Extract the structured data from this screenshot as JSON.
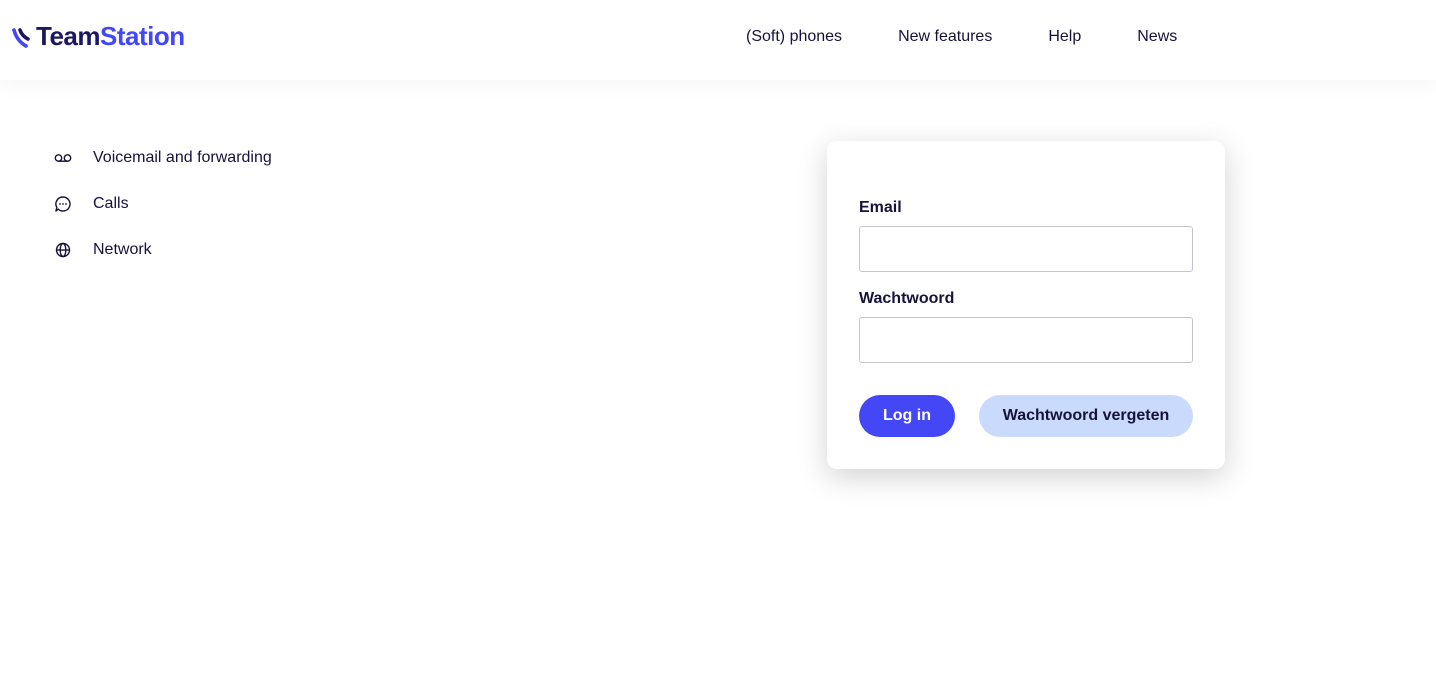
{
  "brand": {
    "name_part1": "Team",
    "name_part2": "Station",
    "icon": "teamstation-logo-icon",
    "color_dark": "#1b1760",
    "color_accent": "#4447f5"
  },
  "nav": {
    "items": [
      {
        "label": "(Soft) phones"
      },
      {
        "label": "New features"
      },
      {
        "label": "Help"
      },
      {
        "label": "News"
      }
    ]
  },
  "sidebar": {
    "items": [
      {
        "label": "Voicemail and forwarding",
        "icon": "voicemail-icon"
      },
      {
        "label": "Calls",
        "icon": "chat-bubble-icon"
      },
      {
        "label": "Network",
        "icon": "globe-icon"
      }
    ]
  },
  "login": {
    "email_label": "Email",
    "email_value": "",
    "password_label": "Wachtwoord",
    "password_value": "",
    "login_button": "Log in",
    "forgot_button": "Wachtwoord vergeten",
    "primary_color": "#4447f5",
    "secondary_color": "#c9dafc"
  }
}
